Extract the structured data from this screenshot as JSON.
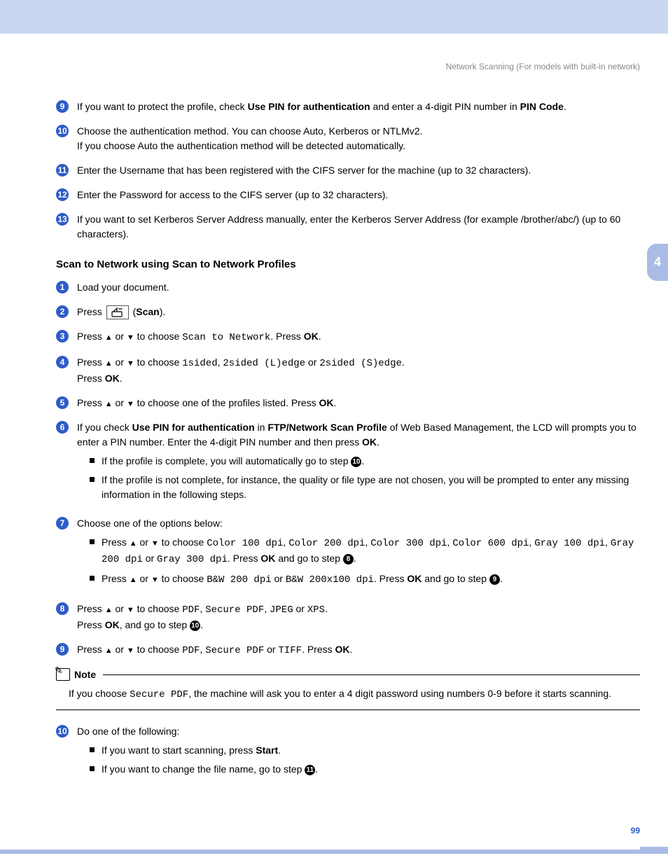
{
  "header": "Network Scanning (For models with built-in network)",
  "chapterTab": "4",
  "pageNumber": "99",
  "sectionA": {
    "steps": [
      {
        "num": "9",
        "html": "If you want to protect the profile, check <b>Use PIN for authentication</b> and enter a 4-digit PIN number in <b>PIN Code</b>."
      },
      {
        "num": "10",
        "html": "Choose the authentication method. You can choose Auto, Kerberos or NTLMv2.<br>If you choose Auto the authentication method will be detected automatically."
      },
      {
        "num": "11",
        "html": "Enter the Username that has been registered with the CIFS server for the machine (up to 32 characters)."
      },
      {
        "num": "12",
        "html": "Enter the Password for access to the CIFS server (up to 32 characters)."
      },
      {
        "num": "13",
        "html": "If you want to set Kerberos Server Address manually, enter the Kerberos Server Address (for example /brother/abc/) (up to 60 characters)."
      }
    ]
  },
  "sectionB": {
    "title": "Scan to Network using Scan to Network Profiles",
    "steps": [
      {
        "num": "1",
        "html": "Load your document."
      },
      {
        "num": "2",
        "html": "Press <span class='scan-btn' data-name='scan-hardware-button-icon' data-interactable='false'><svg width='18' height='14' viewBox='0 0 18 14'><rect x='1' y='6' width='14' height='7' rx='1' fill='none' stroke='#000' stroke-width='1.2'/><path d='M3 6 L8 1 L8 6' fill='none' stroke='#000' stroke-width='1.2'/><path d='M10 2 L15 2' stroke='#000' stroke-width='1.2'/><path d='M14 1 L16 2 L14 3' fill='#000'/></svg></span> (<b>Scan</b>)."
      },
      {
        "num": "3",
        "html": "Press <span class='up-tri'></span> or <span class='down-tri'></span> to choose <span class='mono'>Scan to Network</span>. Press <b>OK</b>."
      },
      {
        "num": "4",
        "html": "Press <span class='up-tri'></span> or <span class='down-tri'></span> to choose <span class='mono'>1sided</span>, <span class='mono'>2sided (L)edge</span> or <span class='mono'>2sided (S)edge</span>.<br>Press <b>OK</b>."
      },
      {
        "num": "5",
        "html": "Press <span class='up-tri'></span> or <span class='down-tri'></span> to choose one of the profiles listed. Press <b>OK</b>."
      },
      {
        "num": "6",
        "html": "If you check <b>Use PIN for authentication</b> in <b>FTP/Network Scan Profile</b> of Web Based Management, the LCD will prompts you to enter a PIN number. Enter the 4-digit PIN number and then press <b>OK</b>.",
        "sub": [
          "If the profile is complete, you will automatically go to step <span class='inline-bullet'>10</span>.",
          "If the profile is not complete, for instance, the quality or file type are not chosen, you will be prompted to enter any missing information in the following steps."
        ]
      },
      {
        "num": "7",
        "html": "Choose one of the options below:",
        "sub": [
          "Press <span class='up-tri'></span> or <span class='down-tri'></span> to choose <span class='mono'>Color 100 dpi</span>, <span class='mono'>Color 200 dpi</span>, <span class='mono'>Color 300 dpi</span>, <span class='mono'>Color 600 dpi</span>, <span class='mono'>Gray 100 dpi</span>, <span class='mono'>Gray 200 dpi</span> or <span class='mono'>Gray 300 dpi</span>. Press <b>OK</b> and go to step <span class='inline-bullet'>8</span>.",
          "Press <span class='up-tri'></span> or <span class='down-tri'></span> to choose <span class='mono'>B&amp;W 200 dpi</span> or <span class='mono'>B&amp;W 200x100 dpi</span>. Press <b>OK</b> and go to step <span class='inline-bullet'>9</span>."
        ]
      },
      {
        "num": "8",
        "html": "Press <span class='up-tri'></span> or <span class='down-tri'></span> to choose <span class='mono'>PDF</span>, <span class='mono'>Secure PDF</span>, <span class='mono'>JPEG</span> or <span class='mono'>XPS</span>.<br>Press <b>OK</b>, and go to step <span class='inline-bullet'>10</span>."
      },
      {
        "num": "9",
        "html": "Press <span class='up-tri'></span> or <span class='down-tri'></span> to choose <span class='mono'>PDF</span>, <span class='mono'>Secure PDF</span> or <span class='mono'>TIFF</span>. Press <b>OK</b>."
      }
    ]
  },
  "note": {
    "label": "Note",
    "body": "If you choose <span class='mono'>Secure PDF</span>, the machine will ask you to enter a 4 digit password using numbers 0-9 before it starts scanning."
  },
  "sectionC": {
    "steps": [
      {
        "num": "10",
        "html": "Do one of the following:",
        "sub": [
          "If you want to start scanning, press <b>Start</b>.",
          "If you want to change the file name, go to step <span class='inline-bullet'>11</span>."
        ]
      }
    ]
  }
}
